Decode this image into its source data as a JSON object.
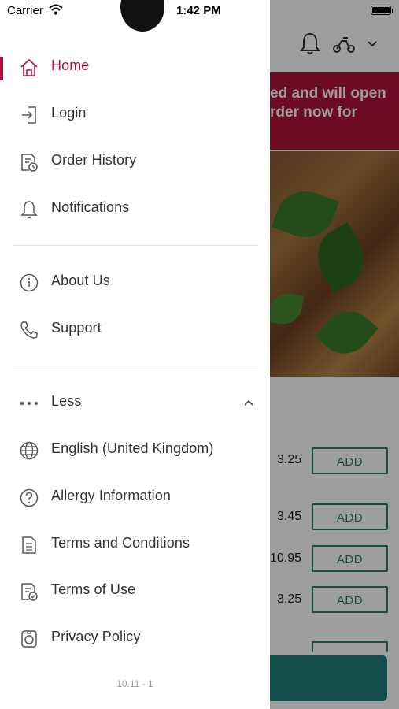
{
  "status_bar": {
    "carrier": "Carrier",
    "time": "1:42 PM"
  },
  "background": {
    "banner_lines": [
      "ed and will open",
      "rder now for"
    ],
    "items": [
      {
        "price": "3.25",
        "add_label": "ADD"
      },
      {
        "price": "3.45",
        "add_label": "ADD"
      },
      {
        "price": "10.95",
        "add_label": "ADD"
      },
      {
        "price": "3.25",
        "add_label": "ADD"
      }
    ]
  },
  "drawer": {
    "main_items": [
      {
        "label": "Home",
        "icon": "home-icon",
        "active": true
      },
      {
        "label": "Login",
        "icon": "login-icon"
      },
      {
        "label": "Order History",
        "icon": "order-history-icon"
      },
      {
        "label": "Notifications",
        "icon": "bell-icon"
      }
    ],
    "info_items": [
      {
        "label": "About Us",
        "icon": "info-icon"
      },
      {
        "label": "Support",
        "icon": "phone-icon"
      }
    ],
    "more_toggle": {
      "label": "Less",
      "icon": "more-dots-icon"
    },
    "more_items": [
      {
        "label": "English (United Kingdom)",
        "icon": "globe-icon"
      },
      {
        "label": "Allergy Information",
        "icon": "question-icon"
      },
      {
        "label": "Terms and Conditions",
        "icon": "document-icon"
      },
      {
        "label": "Terms of Use",
        "icon": "document-check-icon"
      },
      {
        "label": "Privacy Policy",
        "icon": "privacy-icon"
      }
    ],
    "version": "10.11 - 1"
  },
  "colors": {
    "accent": "#b1133d",
    "add_button": "#2a7f62",
    "bottom_button": "#1d7f79"
  }
}
